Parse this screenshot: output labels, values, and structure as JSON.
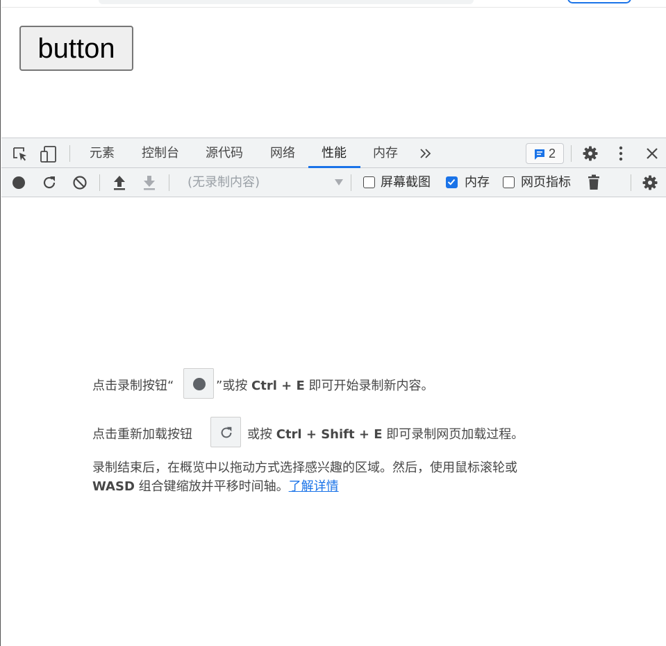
{
  "page": {
    "button_label": "button"
  },
  "devtools": {
    "tabs": [
      {
        "label": "元素"
      },
      {
        "label": "控制台"
      },
      {
        "label": "源代码"
      },
      {
        "label": "网络"
      },
      {
        "label": "性能",
        "active": true
      },
      {
        "label": "内存"
      }
    ],
    "more_tabs_icon": "chevron-double-right-icon",
    "issues_count": "2",
    "toolbar": {
      "recording_select_placeholder": "(无录制内容)",
      "checkboxes": [
        {
          "label": "屏幕截图",
          "checked": false
        },
        {
          "label": "内存",
          "checked": true
        },
        {
          "label": "网页指标",
          "checked": false
        }
      ]
    },
    "landing": {
      "line1_prefix": "点击录制按钮“",
      "line1_mid": "”或按 ",
      "line1_keys": "Ctrl + E",
      "line1_suffix": " 即可开始录制新内容。",
      "line2_prefix": "点击重新加载按钮",
      "line2_mid": "或按 ",
      "line2_keys": "Ctrl + Shift + E",
      "line2_suffix": " 即可录制网页加载过程。",
      "line3": "录制结束后，在概览中以拖动方式选择感兴趣的区域。然后，使用鼠标滚轮或",
      "line4_keys": "WASD",
      "line4_text": " 组合键缩放并平移时间轴。",
      "learn_more": "了解详情"
    },
    "colors": {
      "accent": "#1a73e8",
      "toolbar_bg": "#f1f3f4",
      "text": "#474747"
    }
  }
}
